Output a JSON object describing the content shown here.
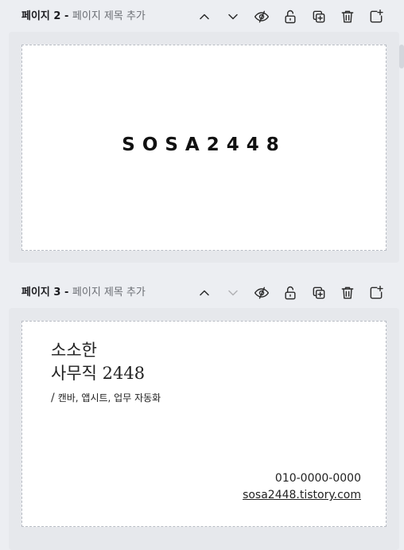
{
  "pages": [
    {
      "number_label": "페이지 2",
      "separator": " - ",
      "title_placeholder": "페이지 제목 추가",
      "brand": "SOSA2448",
      "move_down_disabled": false
    },
    {
      "number_label": "페이지 3",
      "separator": " - ",
      "title_placeholder": "페이지 제목 추가",
      "move_down_disabled": true,
      "card": {
        "name_line1": "소소한",
        "name_line2": "사무직 2448",
        "tag_slash": "/",
        "tagline": "캔바, 앱시트, 업무 자동화",
        "phone": "010-0000-0000",
        "url": "sosa2448.tistory.com"
      }
    }
  ],
  "toolbar_icons": [
    "chevron-up-icon",
    "chevron-down-icon",
    "eye-hide-icon",
    "lock-open-icon",
    "duplicate-icon",
    "trash-icon",
    "add-page-icon"
  ],
  "colors": {
    "background": "#eceef2",
    "card": "#ffffff",
    "text": "#1b1b1f",
    "muted": "#6a6d73"
  }
}
